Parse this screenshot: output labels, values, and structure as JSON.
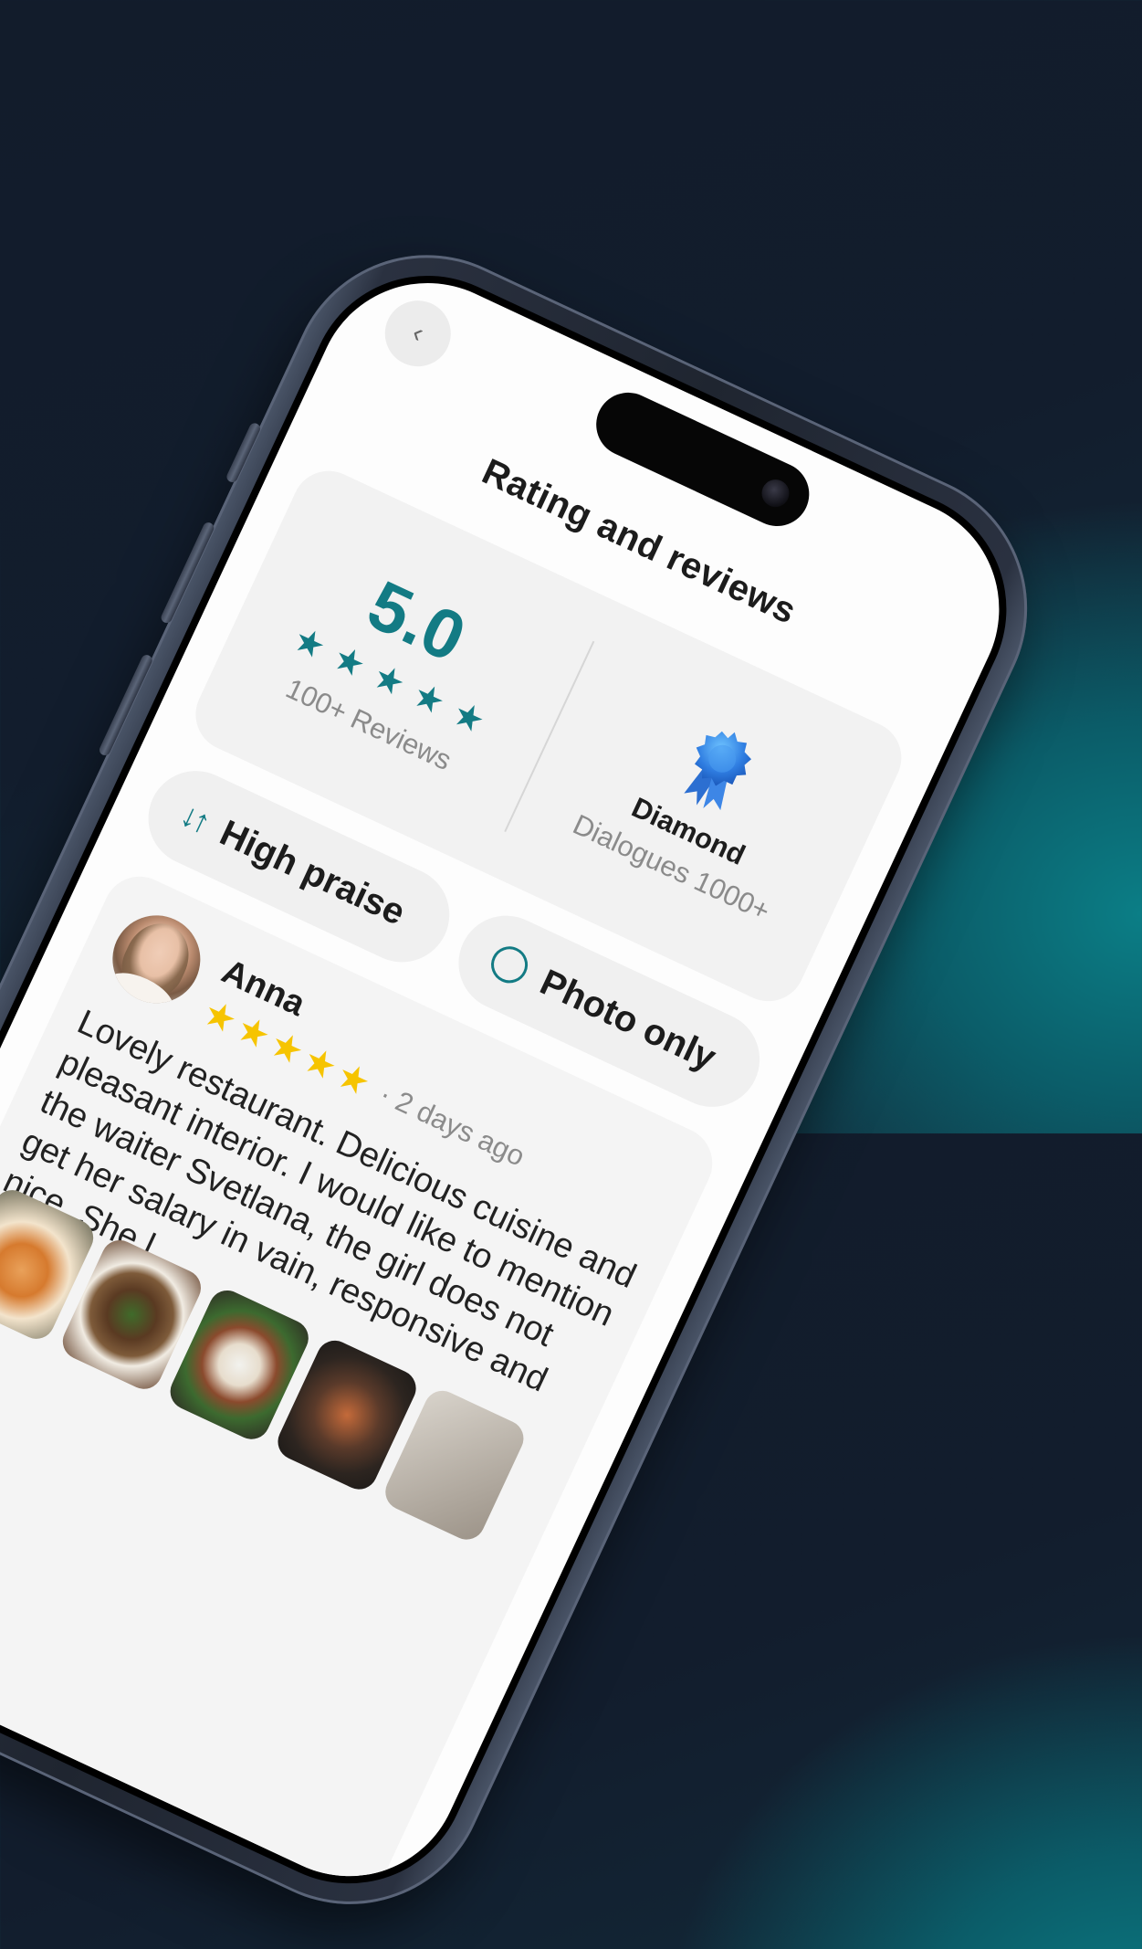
{
  "screen": {
    "title": "Rating and reviews",
    "back_icon": "‹"
  },
  "rating": {
    "score": "5.0",
    "stars": 5,
    "reviews_count": "100+ Reviews",
    "badge_title": "Diamond",
    "badge_subtitle": "Dialogues 1000+"
  },
  "filters": {
    "sort_icon": "↓↑",
    "sort_label": "High praise",
    "photo_label": "Photo only"
  },
  "review": {
    "name": "Anna",
    "stars": 5,
    "date": "· 2 days ago",
    "text": "Lovely restaurant. Delicious cuisine and pleasant interior. I would like to mention the waiter Svetlana, the girl does not get her salary in vain, responsive and nice. She l"
  },
  "colors": {
    "accent": "#137b84",
    "star_gold": "#f6c400",
    "badge_blue": "#2f7de1"
  }
}
